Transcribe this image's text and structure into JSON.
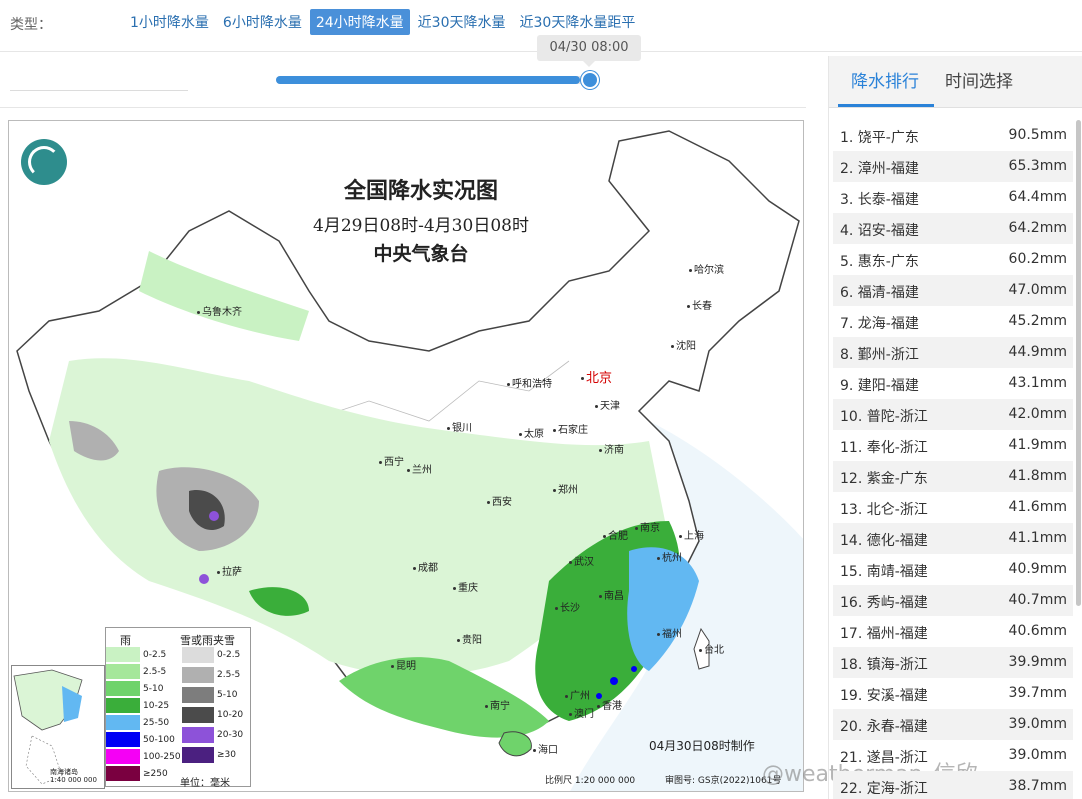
{
  "type_bar": {
    "label": "类型：",
    "tabs": [
      {
        "label": "1小时降水量",
        "active": false
      },
      {
        "label": "6小时降水量",
        "active": false
      },
      {
        "label": "24小时降水量",
        "active": true
      },
      {
        "label": "近30天降水量",
        "active": false
      },
      {
        "label": "近30天降水量距平",
        "active": false
      }
    ]
  },
  "time_slider": {
    "current_label": "04/30 08:00",
    "progress": 0.95
  },
  "map": {
    "title": "全国降水实况图",
    "subtitle": "4月29日08时-4月30日08时",
    "org": "中央气象台",
    "cities": [
      {
        "name": "乌鲁木齐"
      },
      {
        "name": "哈尔滨"
      },
      {
        "name": "长春"
      },
      {
        "name": "沈阳"
      },
      {
        "name": "呼和浩特"
      },
      {
        "name": "北京",
        "capital": true
      },
      {
        "name": "天津"
      },
      {
        "name": "银川"
      },
      {
        "name": "太原"
      },
      {
        "name": "石家庄"
      },
      {
        "name": "济南"
      },
      {
        "name": "西宁"
      },
      {
        "name": "兰州"
      },
      {
        "name": "西安"
      },
      {
        "name": "郑州"
      },
      {
        "name": "南京"
      },
      {
        "name": "合肥"
      },
      {
        "name": "上海"
      },
      {
        "name": "杭州"
      },
      {
        "name": "武汉"
      },
      {
        "name": "成都"
      },
      {
        "name": "拉萨"
      },
      {
        "name": "重庆"
      },
      {
        "name": "长沙"
      },
      {
        "name": "南昌"
      },
      {
        "name": "福州"
      },
      {
        "name": "台北"
      },
      {
        "name": "贵阳"
      },
      {
        "name": "昆明"
      },
      {
        "name": "南宁"
      },
      {
        "name": "广州"
      },
      {
        "name": "澳门"
      },
      {
        "name": "香港"
      },
      {
        "name": "海口"
      }
    ],
    "legend": {
      "rain_title": "雨",
      "snow_title": "雪或雨夹雪",
      "rain_items": [
        {
          "label": "0-2.5",
          "color": "#c9f2c3"
        },
        {
          "label": "2.5-5",
          "color": "#a5e79a"
        },
        {
          "label": "5-10",
          "color": "#6fd36b"
        },
        {
          "label": "10-25",
          "color": "#3aae3a"
        },
        {
          "label": "25-50",
          "color": "#62b8f2"
        },
        {
          "label": "50-100",
          "color": "#0000f5"
        },
        {
          "label": "100-250",
          "color": "#f500f5"
        },
        {
          "label": "≥250",
          "color": "#7a0040"
        }
      ],
      "snow_items": [
        {
          "label": "0-2.5",
          "color": "#dcdcdc"
        },
        {
          "label": "2.5-5",
          "color": "#b0b0b0"
        },
        {
          "label": "5-10",
          "color": "#7d7d7d"
        },
        {
          "label": "10-20",
          "color": "#4b4b4b"
        },
        {
          "label": "20-30",
          "color": "#8d52d9"
        },
        {
          "label": "≥30",
          "color": "#4b2080"
        }
      ],
      "unit": "单位：毫米"
    },
    "inset_caption_1": "南海诸岛",
    "inset_caption_2": "1:40 000 000",
    "made_time": "04月30日08时制作",
    "scale": "比例尺 1:20 000 000",
    "review_no": "审图号: GS京(2022)1061号",
    "watermark": "@weatherman_信欣"
  },
  "panel": {
    "tabs": [
      {
        "label": "降水排行",
        "active": true
      },
      {
        "label": "时间选择",
        "active": false
      }
    ],
    "ranking": [
      {
        "name": "1. 饶平-广东",
        "value": "90.5mm"
      },
      {
        "name": "2. 漳州-福建",
        "value": "65.3mm"
      },
      {
        "name": "3. 长泰-福建",
        "value": "64.4mm"
      },
      {
        "name": "4. 诏安-福建",
        "value": "64.2mm"
      },
      {
        "name": "5. 惠东-广东",
        "value": "60.2mm"
      },
      {
        "name": "6. 福清-福建",
        "value": "47.0mm"
      },
      {
        "name": "7. 龙海-福建",
        "value": "45.2mm"
      },
      {
        "name": "8. 鄞州-浙江",
        "value": "44.9mm"
      },
      {
        "name": "9. 建阳-福建",
        "value": "43.1mm"
      },
      {
        "name": "10. 普陀-浙江",
        "value": "42.0mm"
      },
      {
        "name": "11. 奉化-浙江",
        "value": "41.9mm"
      },
      {
        "name": "12. 紫金-广东",
        "value": "41.8mm"
      },
      {
        "name": "13. 北仑-浙江",
        "value": "41.6mm"
      },
      {
        "name": "14. 德化-福建",
        "value": "41.1mm"
      },
      {
        "name": "15. 南靖-福建",
        "value": "40.9mm"
      },
      {
        "name": "16. 秀屿-福建",
        "value": "40.7mm"
      },
      {
        "name": "17. 福州-福建",
        "value": "40.6mm"
      },
      {
        "name": "18. 镇海-浙江",
        "value": "39.9mm"
      },
      {
        "name": "19. 安溪-福建",
        "value": "39.7mm"
      },
      {
        "name": "20. 永春-福建",
        "value": "39.0mm"
      },
      {
        "name": "21. 遂昌-浙江",
        "value": "39.0mm"
      },
      {
        "name": "22. 定海-浙江",
        "value": "38.7mm"
      }
    ]
  }
}
